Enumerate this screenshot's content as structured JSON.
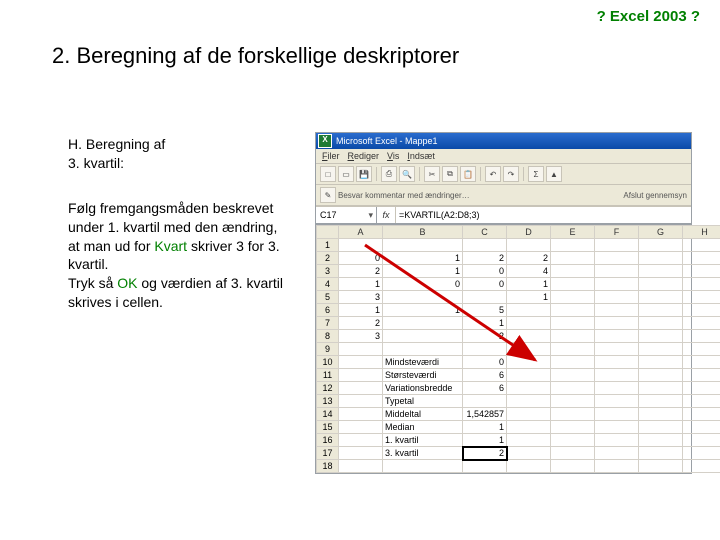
{
  "banner": "? Excel 2003 ?",
  "section_title": "2. Beregning af de forskellige deskriptorer",
  "sub_heading_1": "H. Beregning af",
  "sub_heading_2": "3. kvartil:",
  "body": {
    "p1a": "Følg fremgangsmåden beskrevet under 1. kvartil med den ændring, at man ud for ",
    "kw1": "Kvart",
    "p1b": " skriver 3 for 3. kvartil.",
    "p2a": "Tryk så ",
    "kw2": "OK",
    "p2b": " og værdien af 3. kvartil skrives i cellen."
  },
  "excel": {
    "title": "Microsoft Excel - Mappe1",
    "menus": [
      "Filer",
      "Rediger",
      "Vis",
      "Indsæt"
    ],
    "namebox": "C17",
    "fx": "fx",
    "formula": "=KVARTIL(A2:D8;3)",
    "cols": [
      "",
      "A",
      "B",
      "C",
      "D",
      "E",
      "F",
      "G",
      "H"
    ],
    "rows": [
      {
        "n": "1",
        "a": "",
        "b": "",
        "c": "",
        "d": ""
      },
      {
        "n": "2",
        "a": "0",
        "b": "1",
        "c": "2",
        "d": "2"
      },
      {
        "n": "3",
        "a": "2",
        "b": "1",
        "c": "0",
        "d": "4"
      },
      {
        "n": "4",
        "a": "1",
        "b": "0",
        "c": "0",
        "d": "1"
      },
      {
        "n": "5",
        "a": "3",
        "b": "",
        "c": "",
        "d": "1"
      },
      {
        "n": "6",
        "a": "1",
        "b": "1",
        "c": "5",
        "d": ""
      },
      {
        "n": "7",
        "a": "2",
        "b": "",
        "c": "1",
        "d": ""
      },
      {
        "n": "8",
        "a": "3",
        "b": "",
        "c": "2",
        "d": ""
      },
      {
        "n": "9",
        "a": "",
        "b": "",
        "c": "",
        "d": ""
      },
      {
        "n": "10",
        "b": "Mindsteværdi",
        "c": "0"
      },
      {
        "n": "11",
        "b": "Størsteværdi",
        "c": "6"
      },
      {
        "n": "12",
        "b": "Variationsbredde",
        "c": "6"
      },
      {
        "n": "13",
        "b": "Typetal",
        "c": ""
      },
      {
        "n": "14",
        "b": "Middeltal",
        "c": "1,542857"
      },
      {
        "n": "15",
        "b": "Median",
        "c": "1"
      },
      {
        "n": "16",
        "b": "1. kvartil",
        "c": "1"
      },
      {
        "n": "17",
        "b": "3. kvartil",
        "c": "2",
        "sel": true
      },
      {
        "n": "18",
        "b": "",
        "c": ""
      }
    ]
  }
}
